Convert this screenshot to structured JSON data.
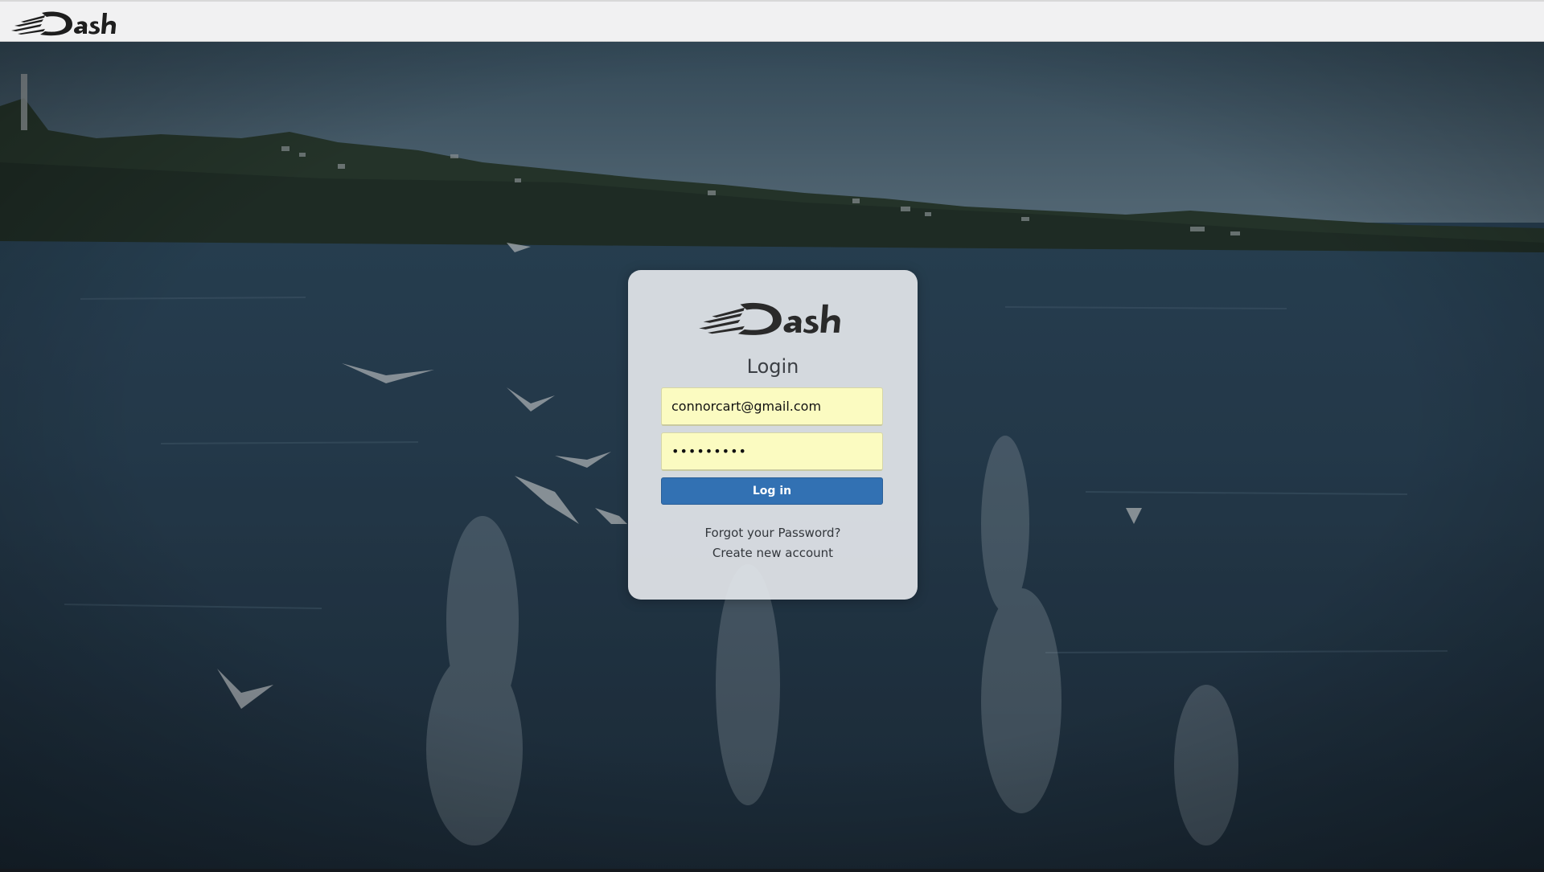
{
  "header": {
    "logo_icon": "dash-logo"
  },
  "background": {
    "description_icon": "sea-photo-background"
  },
  "login": {
    "logo_icon": "dash-logo",
    "title": "Login",
    "email_value": "connorcart@gmail.com",
    "password_value": "•••••••••",
    "login_button_label": "Log in",
    "forgot_password_link": "Forgot your Password?",
    "create_account_link": "Create new account"
  },
  "colors": {
    "input_autofill_bg": "#fbfbc1",
    "button_bg": "#3271b3",
    "card_bg": "#e2e5e9",
    "header_bg": "#f1f1f2"
  }
}
